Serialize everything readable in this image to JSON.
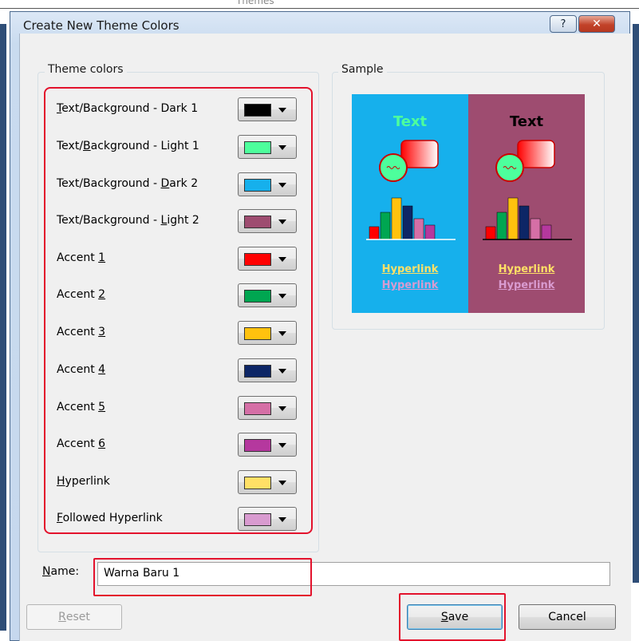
{
  "background": {
    "ghost_text": "Themes"
  },
  "dialog": {
    "title": "Create New Theme Colors",
    "help_label": "?",
    "close_label": "✕"
  },
  "theme_colors": {
    "legend": "Theme colors",
    "items": [
      {
        "pre": "",
        "key": "T",
        "post": "ext/Background - Dark 1",
        "color": "#000000"
      },
      {
        "pre": "Text/",
        "key": "B",
        "post": "ackground - Light 1",
        "color": "#4dff9c"
      },
      {
        "pre": "Text/Background - ",
        "key": "D",
        "post": "ark 2",
        "color": "#16b0ec"
      },
      {
        "pre": "Text/Background - ",
        "key": "L",
        "post": "ight 2",
        "color": "#9e4c70"
      },
      {
        "pre": "Accent ",
        "key": "1",
        "post": "",
        "color": "#ff0000"
      },
      {
        "pre": "Accent ",
        "key": "2",
        "post": "",
        "color": "#00a651"
      },
      {
        "pre": "Accent ",
        "key": "3",
        "post": "",
        "color": "#ffc20e"
      },
      {
        "pre": "Accent ",
        "key": "4",
        "post": "",
        "color": "#0d2666"
      },
      {
        "pre": "Accent ",
        "key": "5",
        "post": "",
        "color": "#d56fa6"
      },
      {
        "pre": "Accent ",
        "key": "6",
        "post": "",
        "color": "#b5389e"
      },
      {
        "pre": "",
        "key": "H",
        "post": "yperlink",
        "color": "#ffe066"
      },
      {
        "pre": "",
        "key": "F",
        "post": "ollowed Hyperlink",
        "color": "#d99bd0"
      }
    ]
  },
  "sample": {
    "legend": "Sample",
    "left": {
      "text": "Text",
      "hyperlink": "Hyperlink",
      "followed": "Hyperlink"
    },
    "right": {
      "text": "Text",
      "hyperlink": "Hyperlink",
      "followed": "Hyperlink"
    }
  },
  "name_field": {
    "label_key": "N",
    "label_rest": "ame:",
    "value": "Warna Baru 1"
  },
  "buttons": {
    "reset_key": "R",
    "reset_rest": "eset",
    "save_key": "S",
    "save_rest": "ave",
    "cancel": "Cancel"
  }
}
